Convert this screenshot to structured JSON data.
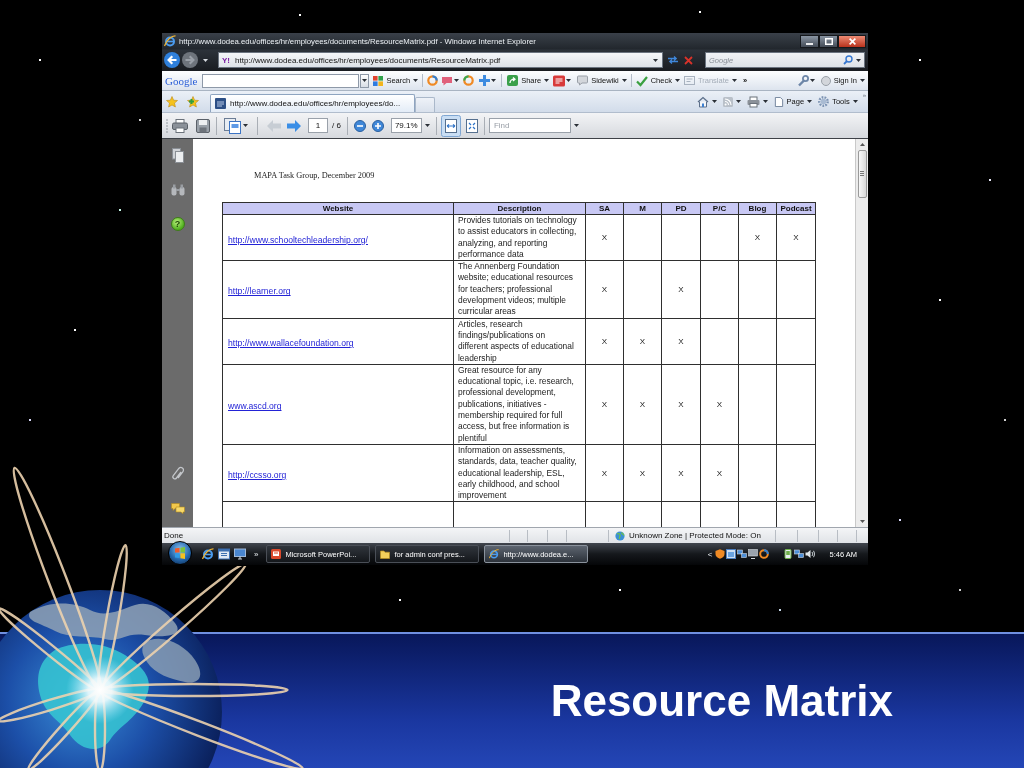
{
  "window": {
    "title": "http://www.dodea.edu/offices/hr/employees/documents/ResourceMatrix.pdf - Windows Internet Explorer"
  },
  "navigation": {
    "back": {
      "disabled": false
    },
    "forward": {
      "disabled": true
    }
  },
  "address_bar": {
    "site_logo": "Y!",
    "url": "http://www.dodea.edu/offices/hr/employees/documents/ResourceMatrix.pdf",
    "search": {
      "placeholder": "Google"
    }
  },
  "google_toolbar": {
    "logo": "Google",
    "search_button": "Search",
    "share_button": "Share",
    "sidewiki_button": "Sidewiki",
    "check_button": "Check",
    "translate_button": {
      "label": "Translate",
      "disabled": true
    },
    "overflow": "»",
    "sign_in_button": "Sign In"
  },
  "tabs": [
    {
      "label": "http://www.dodea.edu/offices/hr/employees/do...",
      "selected": true
    }
  ],
  "command_bar": {
    "page_button": "Page",
    "tools_button": "Tools",
    "overflow": "»"
  },
  "pdf_toolbar": {
    "previous_page": {
      "disabled": true
    },
    "next_page": {
      "disabled": false
    },
    "page_number": "1",
    "page_count": "/ 6",
    "zoom": "79.1%",
    "fit_width": {
      "selected": true
    },
    "fit_page": {
      "selected": false
    },
    "find": {
      "placeholder": "Find"
    }
  },
  "sidebar": {
    "help_button": "?"
  },
  "document": {
    "heading": "MAPA Task Group, December 2009",
    "table": {
      "columns": [
        "Website",
        "Description",
        "SA",
        "M",
        "PD",
        "P/C",
        "Blog",
        "Podcast"
      ],
      "rows": [
        {
          "website": "http://www.schooltechleadership.org/",
          "description": "Provides tutorials on technology\nto assist educators in collecting,\nanalyzing, and reporting\nperformance data",
          "sa": "X",
          "blog": "X",
          "podcast": "X"
        },
        {
          "website": "http://learner.org",
          "description": "The Annenberg Foundation\nwebsite; educational resources\nfor teachers; professional\ndevelopment videos; multiple\ncurricular areas",
          "sa": "X",
          "pd": "X"
        },
        {
          "website": "http://www.wallacefoundation.org",
          "description": "Articles, research\nfindings/publications on\ndifferent aspects of educational\nleadership",
          "sa": "X",
          "m": "X",
          "pd": "X"
        },
        {
          "website": "www.ascd.org",
          "description": "Great resource for any\neducational topic, i.e. research,\nprofessional development,\npublications, initiatives -\nmembership required for full\naccess, but free information is\nplentiful",
          "sa": "X",
          "m": "X",
          "pd": "X",
          "pc": "X"
        },
        {
          "website": "http://ccsso.org",
          "description": "Information on assessments,\nstandards, data, teacher quality,\neducational leadership, ESL,\nearly childhood, and school\nimprovement",
          "sa": "X",
          "m": "X",
          "pd": "X",
          "pc": "X"
        }
      ]
    }
  },
  "status_bar": {
    "text": "Done",
    "zone": "Unknown Zone | Protected Mode: On"
  },
  "taskbar": {
    "quick_launch_overflow": "»",
    "tasks": [
      {
        "kind": "presentation",
        "label": "Microsoft PowerPoi...",
        "selected": false
      },
      {
        "kind": "folder",
        "label": "for admin conf pres...",
        "selected": false
      },
      {
        "kind": "browser",
        "label": "http://www.dodea.e...",
        "selected": true
      }
    ],
    "tray_expand": "<",
    "clock": "5:46 AM"
  },
  "slide": {
    "title": "Resource Matrix"
  }
}
